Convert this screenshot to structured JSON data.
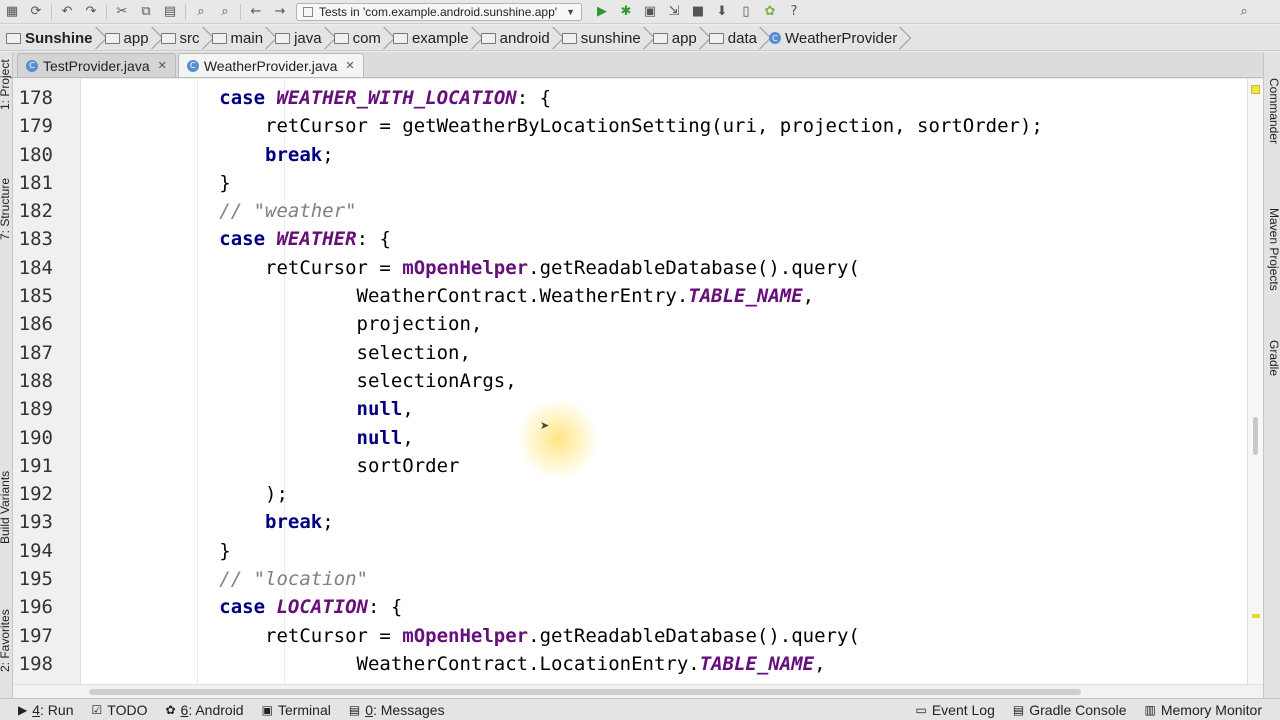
{
  "toolbar": {
    "run_config": "Tests in 'com.example.android.sunshine.app'",
    "icons": [
      "save-icon",
      "sync-icon",
      "undo-icon",
      "redo-icon",
      "cut-icon",
      "copy-icon",
      "paste-icon",
      "find-icon",
      "replace-icon",
      "back-icon",
      "forward-icon",
      "run-icon",
      "debug-icon",
      "coverage-icon",
      "attach-icon",
      "stop-icon",
      "sdk-icon",
      "avd-icon",
      "android-icon",
      "help-icon",
      "search-icon"
    ]
  },
  "breadcrumb": [
    "Sunshine",
    "app",
    "src",
    "main",
    "java",
    "com",
    "example",
    "android",
    "sunshine",
    "app",
    "data",
    "WeatherProvider"
  ],
  "tabs": [
    {
      "label": "TestProvider.java",
      "active": false
    },
    {
      "label": "WeatherProvider.java",
      "active": true
    }
  ],
  "left_tools": [
    "1: Project",
    "7: Structure",
    "Build Variants",
    "2: Favorites"
  ],
  "right_tools": [
    "Commander",
    "Maven Projects",
    "Gradle"
  ],
  "code_lines": [
    {
      "n": "178",
      "tokens": [
        {
          "t": "            "
        },
        {
          "t": "case ",
          "c": "kw"
        },
        {
          "t": "WEATHER_WITH_LOCATION",
          "c": "cst"
        },
        {
          "t": ": {"
        }
      ]
    },
    {
      "n": "179",
      "tokens": [
        {
          "t": "                retCursor = getWeatherByLocationSetting(uri, projection, sortOrder);"
        }
      ]
    },
    {
      "n": "180",
      "tokens": [
        {
          "t": "                "
        },
        {
          "t": "break",
          "c": "kw"
        },
        {
          "t": ";"
        }
      ]
    },
    {
      "n": "181",
      "tokens": [
        {
          "t": "            }"
        }
      ]
    },
    {
      "n": "182",
      "tokens": [
        {
          "t": "            "
        },
        {
          "t": "// \"weather\"",
          "c": "cm"
        }
      ]
    },
    {
      "n": "183",
      "tokens": [
        {
          "t": "            "
        },
        {
          "t": "case ",
          "c": "kw"
        },
        {
          "t": "WEATHER",
          "c": "cst"
        },
        {
          "t": ": {"
        }
      ]
    },
    {
      "n": "184",
      "tokens": [
        {
          "t": "                retCursor = "
        },
        {
          "t": "mOpenHelper",
          "c": "fld"
        },
        {
          "t": ".getReadableDatabase().query("
        }
      ]
    },
    {
      "n": "185",
      "tokens": [
        {
          "t": "                        WeatherContract.WeatherEntry."
        },
        {
          "t": "TABLE_NAME",
          "c": "cst"
        },
        {
          "t": ","
        }
      ]
    },
    {
      "n": "186",
      "tokens": [
        {
          "t": "                        projection,"
        }
      ]
    },
    {
      "n": "187",
      "tokens": [
        {
          "t": "                        selection,"
        }
      ]
    },
    {
      "n": "188",
      "tokens": [
        {
          "t": "                        selectionArgs,"
        }
      ]
    },
    {
      "n": "189",
      "tokens": [
        {
          "t": "                        "
        },
        {
          "t": "null",
          "c": "kw"
        },
        {
          "t": ","
        }
      ]
    },
    {
      "n": "190",
      "tokens": [
        {
          "t": "                        "
        },
        {
          "t": "null",
          "c": "kw"
        },
        {
          "t": ","
        }
      ]
    },
    {
      "n": "191",
      "tokens": [
        {
          "t": "                        sortOrder"
        }
      ]
    },
    {
      "n": "192",
      "tokens": [
        {
          "t": "                );"
        }
      ]
    },
    {
      "n": "193",
      "tokens": [
        {
          "t": "                "
        },
        {
          "t": "break",
          "c": "kw"
        },
        {
          "t": ";"
        }
      ]
    },
    {
      "n": "194",
      "tokens": [
        {
          "t": "            }"
        }
      ]
    },
    {
      "n": "195",
      "tokens": [
        {
          "t": "            "
        },
        {
          "t": "// \"location\"",
          "c": "cm"
        }
      ]
    },
    {
      "n": "196",
      "tokens": [
        {
          "t": "            "
        },
        {
          "t": "case ",
          "c": "kw"
        },
        {
          "t": "LOCATION",
          "c": "cst"
        },
        {
          "t": ": {"
        }
      ]
    },
    {
      "n": "197",
      "tokens": [
        {
          "t": "                retCursor = "
        },
        {
          "t": "mOpenHelper",
          "c": "fld"
        },
        {
          "t": ".getReadableDatabase().query("
        }
      ]
    },
    {
      "n": "198",
      "tokens": [
        {
          "t": "                        WeatherContract.LocationEntry."
        },
        {
          "t": "TABLE_NAME",
          "c": "cst"
        },
        {
          "t": ","
        }
      ]
    }
  ],
  "bottom_tools": {
    "left": [
      {
        "key": "4",
        "label": ": Run",
        "icon": "run-icon",
        "glyph": "▶"
      },
      {
        "key": "",
        "label": "TODO",
        "icon": "todo-icon",
        "glyph": "☑"
      },
      {
        "key": "6",
        "label": ": Android",
        "icon": "android-icon",
        "glyph": "✿"
      },
      {
        "key": "",
        "label": "Terminal",
        "icon": "terminal-icon",
        "glyph": "▣"
      },
      {
        "key": "0",
        "label": ": Messages",
        "icon": "messages-icon",
        "glyph": "▤"
      }
    ],
    "right": [
      {
        "key": "",
        "label": "Event Log",
        "icon": "event-log-icon",
        "glyph": "▭"
      },
      {
        "key": "",
        "label": "Gradle Console",
        "icon": "gradle-console-icon",
        "glyph": "▤"
      },
      {
        "key": "",
        "label": "Memory Monitor",
        "icon": "memory-monitor-icon",
        "glyph": "▥"
      }
    ]
  },
  "colors": {
    "keyword": "#000080",
    "constant": "#660e7a",
    "comment": "#808080"
  }
}
